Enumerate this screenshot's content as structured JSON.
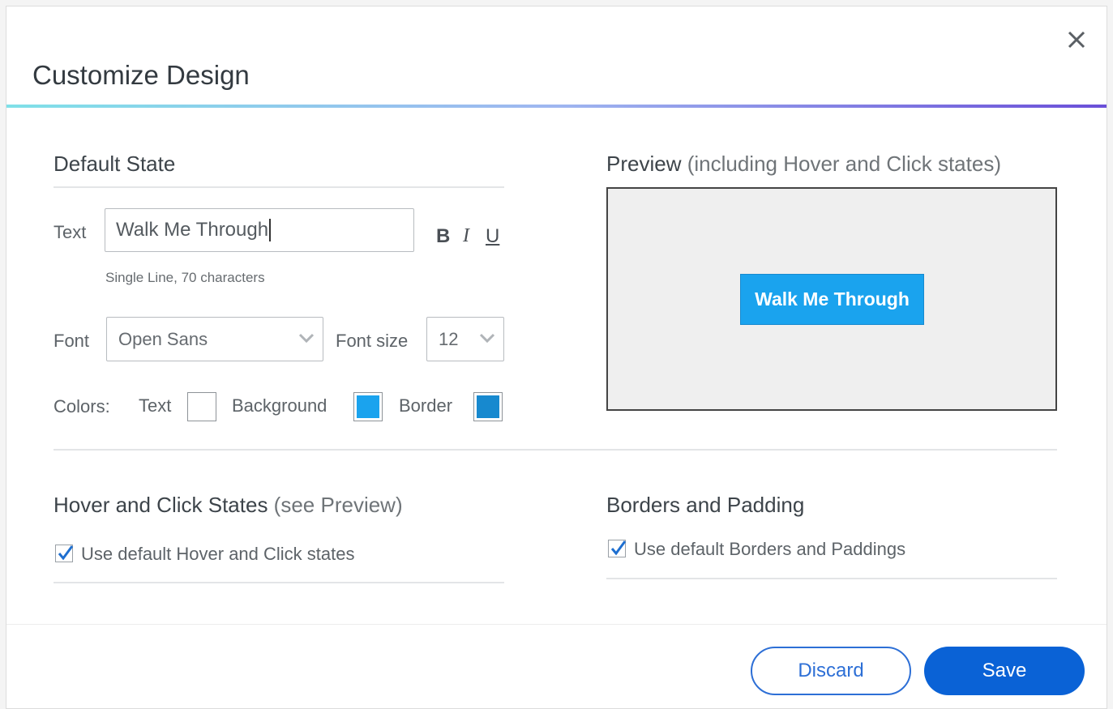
{
  "dialog": {
    "title": "Customize Design",
    "close_icon": "close-icon"
  },
  "default_state": {
    "title": "Default State",
    "text_label": "Text",
    "text_value": "Walk Me Through",
    "format_buttons": {
      "bold": "B",
      "italic": "I",
      "underline": "U"
    },
    "hint": "Single Line, 70 characters",
    "font_label": "Font",
    "font_value": "Open Sans",
    "font_size_label": "Font size",
    "font_size_value": "12",
    "colors_label": "Colors:",
    "color_text_label": "Text",
    "color_background_label": "Background",
    "color_border_label": "Border",
    "colors": {
      "text": "#ffffff",
      "background": "#1aa3ee",
      "border": "#1789cf"
    }
  },
  "preview": {
    "title_main": "Preview",
    "title_sub": " (including Hover and Click states)",
    "button_text": "Walk Me Through"
  },
  "hover_click": {
    "title_main": "Hover and Click States",
    "title_sub": " (see Preview)",
    "checkbox_label": "Use default Hover and Click states",
    "checked": true
  },
  "borders_padding": {
    "title": "Borders and Padding",
    "checkbox_label": "Use default Borders and Paddings",
    "checked": true
  },
  "footer": {
    "discard_label": "Discard",
    "save_label": "Save"
  },
  "theme": {
    "accent": "#0a62d6",
    "preview_button": "#1aa3ee",
    "check_color": "#1e6fd0"
  }
}
